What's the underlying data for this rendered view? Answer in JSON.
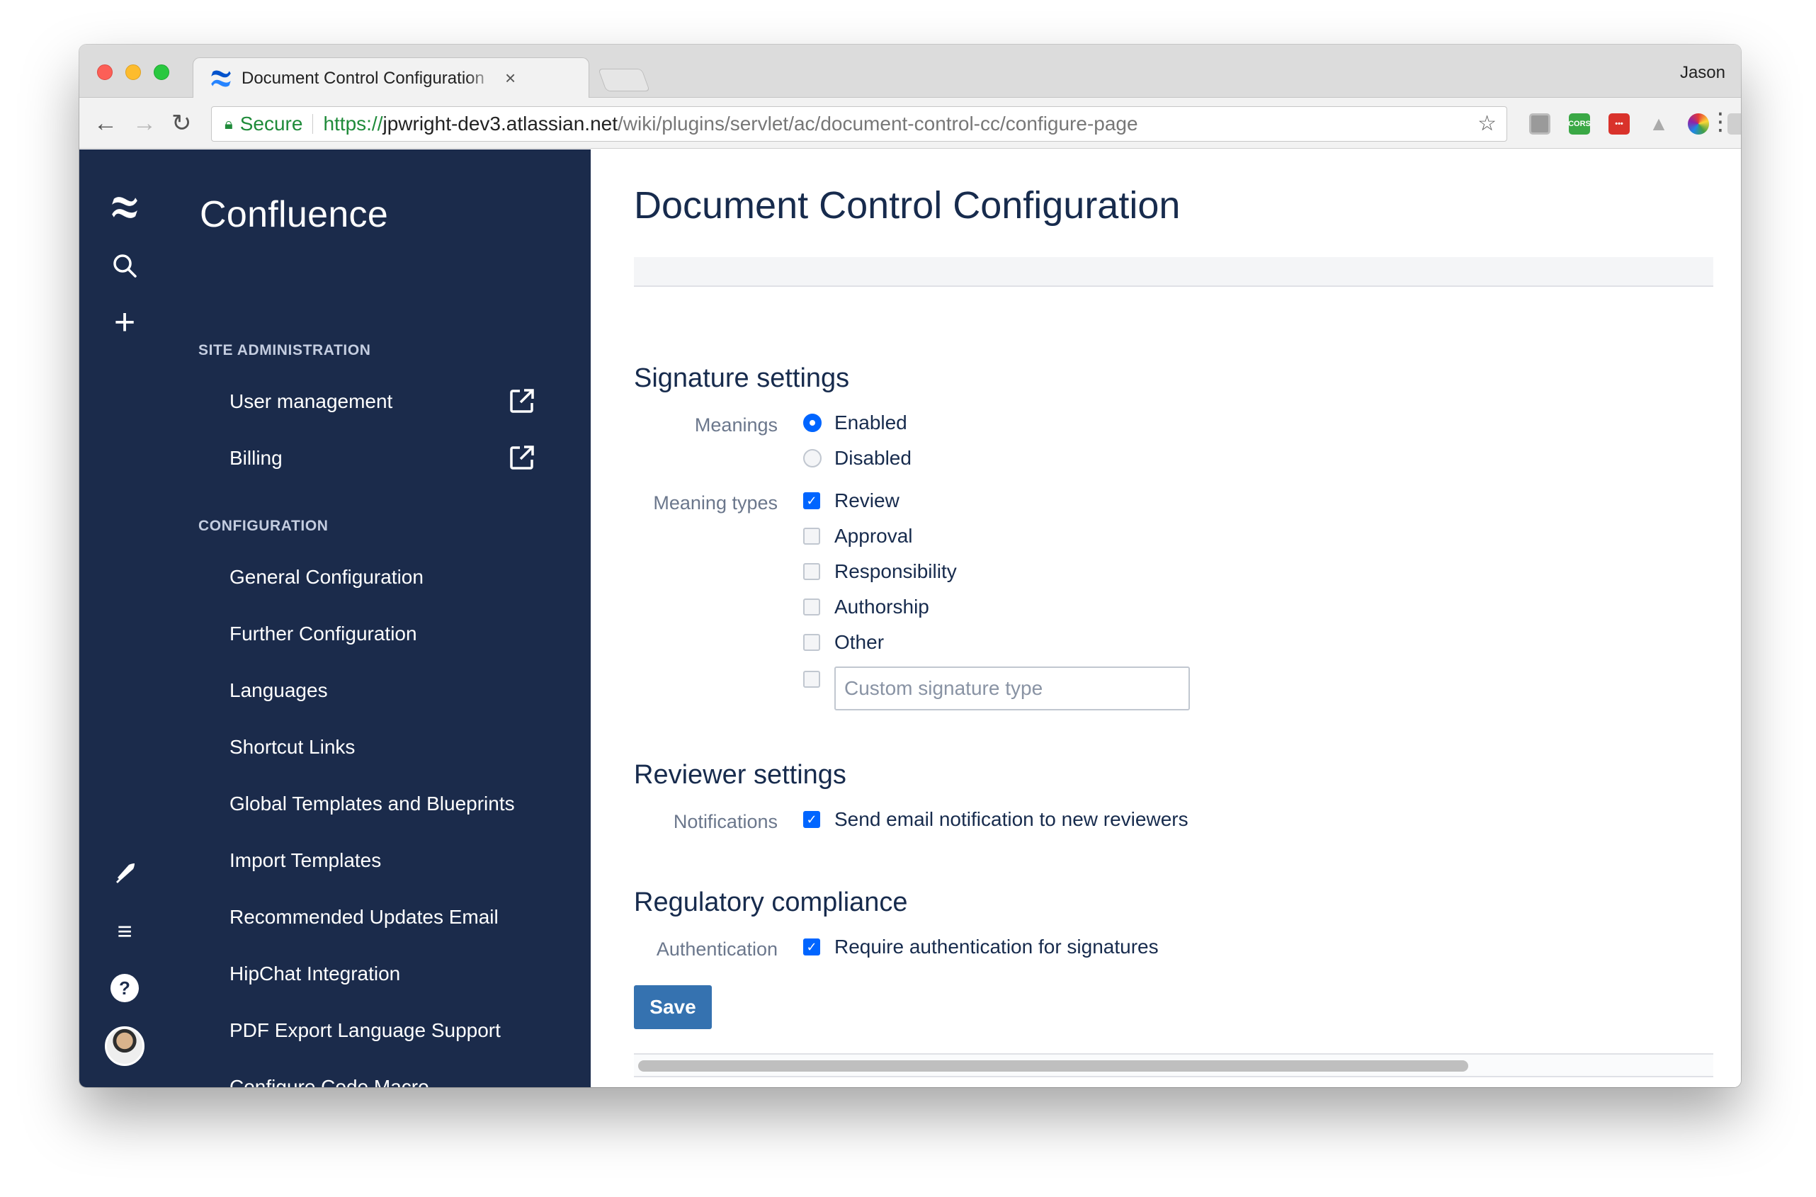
{
  "browser": {
    "tab_title": "Document Control Configuration",
    "tab_close": "×",
    "profile_name": "Jason",
    "secure_label": "Secure",
    "url_scheme": "https://",
    "url_host": "jpwright-dev3.atlassian.net",
    "url_path": "/wiki/plugins/servlet/ac/document-control-cc/configure-page",
    "extensions": [
      "generic-extension-icon",
      "cors-extension-icon",
      "lastpass-extension-icon",
      "drive-extension-icon",
      "color-picker-extension-icon",
      "window-extension-icon"
    ],
    "cors_label": "CORS"
  },
  "sidebar": {
    "app_name": "Confluence",
    "sections": [
      {
        "heading": "SITE ADMINISTRATION",
        "items": [
          {
            "label": "User management",
            "external": true
          },
          {
            "label": "Billing",
            "external": true
          }
        ]
      },
      {
        "heading": "CONFIGURATION",
        "items": [
          {
            "label": "General Configuration"
          },
          {
            "label": "Further Configuration"
          },
          {
            "label": "Languages"
          },
          {
            "label": "Shortcut Links"
          },
          {
            "label": "Global Templates and Blueprints"
          },
          {
            "label": "Import Templates"
          },
          {
            "label": "Recommended Updates Email"
          },
          {
            "label": "HipChat Integration"
          },
          {
            "label": "PDF Export Language Support"
          },
          {
            "label": "Configure Code Macro"
          }
        ]
      }
    ]
  },
  "main": {
    "title": "Document Control Configuration",
    "signature": {
      "heading": "Signature settings",
      "meanings_label": "Meanings",
      "meanings_options": [
        {
          "label": "Enabled",
          "selected": true
        },
        {
          "label": "Disabled",
          "selected": false
        }
      ],
      "types_label": "Meaning types",
      "types": [
        {
          "label": "Review",
          "checked": true
        },
        {
          "label": "Approval",
          "checked": false
        },
        {
          "label": "Responsibility",
          "checked": false
        },
        {
          "label": "Authorship",
          "checked": false
        },
        {
          "label": "Other",
          "checked": false
        }
      ],
      "custom_placeholder": "Custom signature type",
      "custom_checked": false
    },
    "reviewer": {
      "heading": "Reviewer settings",
      "label": "Notifications",
      "option": "Send email notification to new reviewers",
      "checked": true
    },
    "regulatory": {
      "heading": "Regulatory compliance",
      "label": "Authentication",
      "option": "Require authentication for signatures",
      "checked": true
    },
    "save_label": "Save"
  }
}
